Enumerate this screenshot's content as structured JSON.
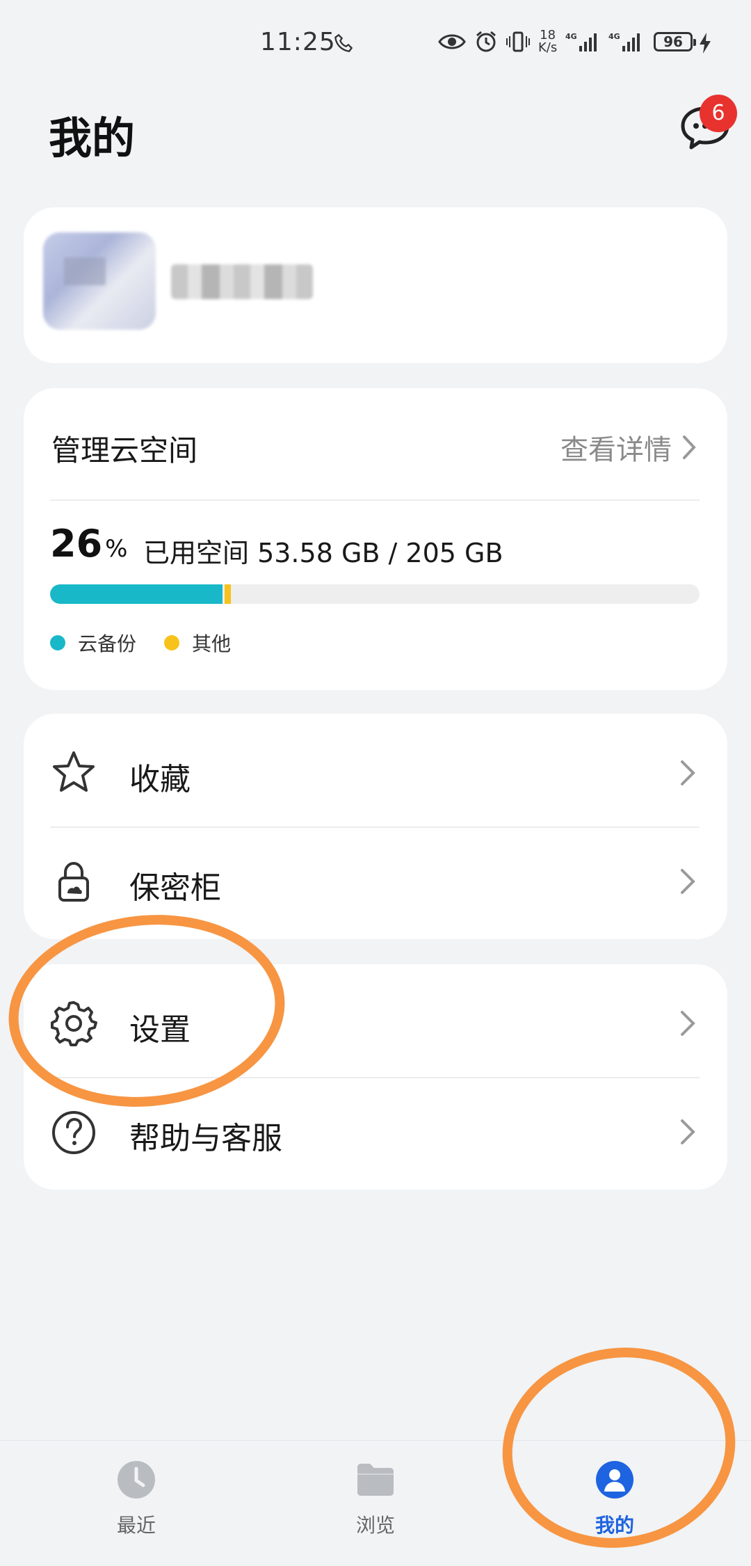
{
  "status_bar": {
    "time": "11:25",
    "net_speed_value": "18",
    "net_speed_unit": "K/s",
    "network_1": "4G",
    "network_2": "4G",
    "battery": "96"
  },
  "header": {
    "title": "我的",
    "message_badge": "6"
  },
  "storage": {
    "title": "管理云空间",
    "detail_link": "查看详情",
    "percent": "26",
    "percent_symbol": "%",
    "usage_text": "已用空间 53.58 GB / 205 GB",
    "backup_fraction": 0.265,
    "other_fraction": 0.01,
    "legend": [
      {
        "label": "云备份",
        "color": "#18b8c8"
      },
      {
        "label": "其他",
        "color": "#f7c21b"
      }
    ]
  },
  "menu_group_1": [
    {
      "label": "收藏",
      "icon": "star-icon"
    },
    {
      "label": "保密柜",
      "icon": "lock-icon"
    }
  ],
  "menu_group_2": [
    {
      "label": "设置",
      "icon": "gear-icon"
    },
    {
      "label": "帮助与客服",
      "icon": "help-icon"
    }
  ],
  "bottom_nav": [
    {
      "label": "最近",
      "icon": "clock-icon",
      "active": false
    },
    {
      "label": "浏览",
      "icon": "folder-icon",
      "active": false
    },
    {
      "label": "我的",
      "icon": "user-icon",
      "active": true
    }
  ],
  "colors": {
    "accent": "#1e63e0",
    "annotation": "#f7913a",
    "badge": "#e8322e"
  }
}
